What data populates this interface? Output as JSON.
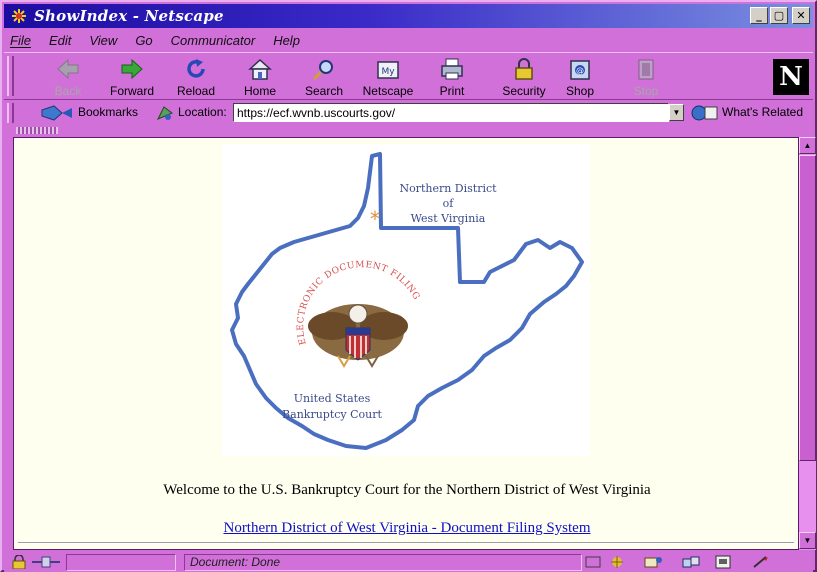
{
  "window": {
    "title": "ShowIndex - Netscape"
  },
  "menu": [
    {
      "label": "File",
      "key": "F"
    },
    {
      "label": "Edit",
      "key": "E"
    },
    {
      "label": "View",
      "key": "V"
    },
    {
      "label": "Go",
      "key": "G"
    },
    {
      "label": "Communicator",
      "key": "C"
    },
    {
      "label": "Help",
      "key": "H"
    }
  ],
  "toolbar": {
    "back": "Back",
    "forward": "Forward",
    "reload": "Reload",
    "home": "Home",
    "search": "Search",
    "netscape": "Netscape",
    "print": "Print",
    "security": "Security",
    "shop": "Shop",
    "stop": "Stop",
    "netscape_logo": "N"
  },
  "location": {
    "bookmarks_label": "Bookmarks",
    "location_label": "Location:",
    "url": "https://ecf.wvnb.uscourts.gov/",
    "whats_related": "What's Related"
  },
  "logo": {
    "district_line1": "Northern District",
    "district_line2": "of",
    "district_line3": "West Virginia",
    "arc_text": "ELECTRONIC DOCUMENT FILING",
    "court_line1": "United States",
    "court_line2": "Bankruptcy Court"
  },
  "page": {
    "welcome": "Welcome to the U.S. Bankruptcy Court for the Northern District of West Virginia",
    "link": "Northern District of West Virginia - Document Filing System"
  },
  "status": {
    "text": "Document: Done"
  },
  "colors": {
    "chrome": "#d070d8",
    "title_start": "#1c0ca0",
    "page_bg": "#fffff0",
    "link": "#1010c8",
    "map_outline": "#4a6fc0"
  }
}
